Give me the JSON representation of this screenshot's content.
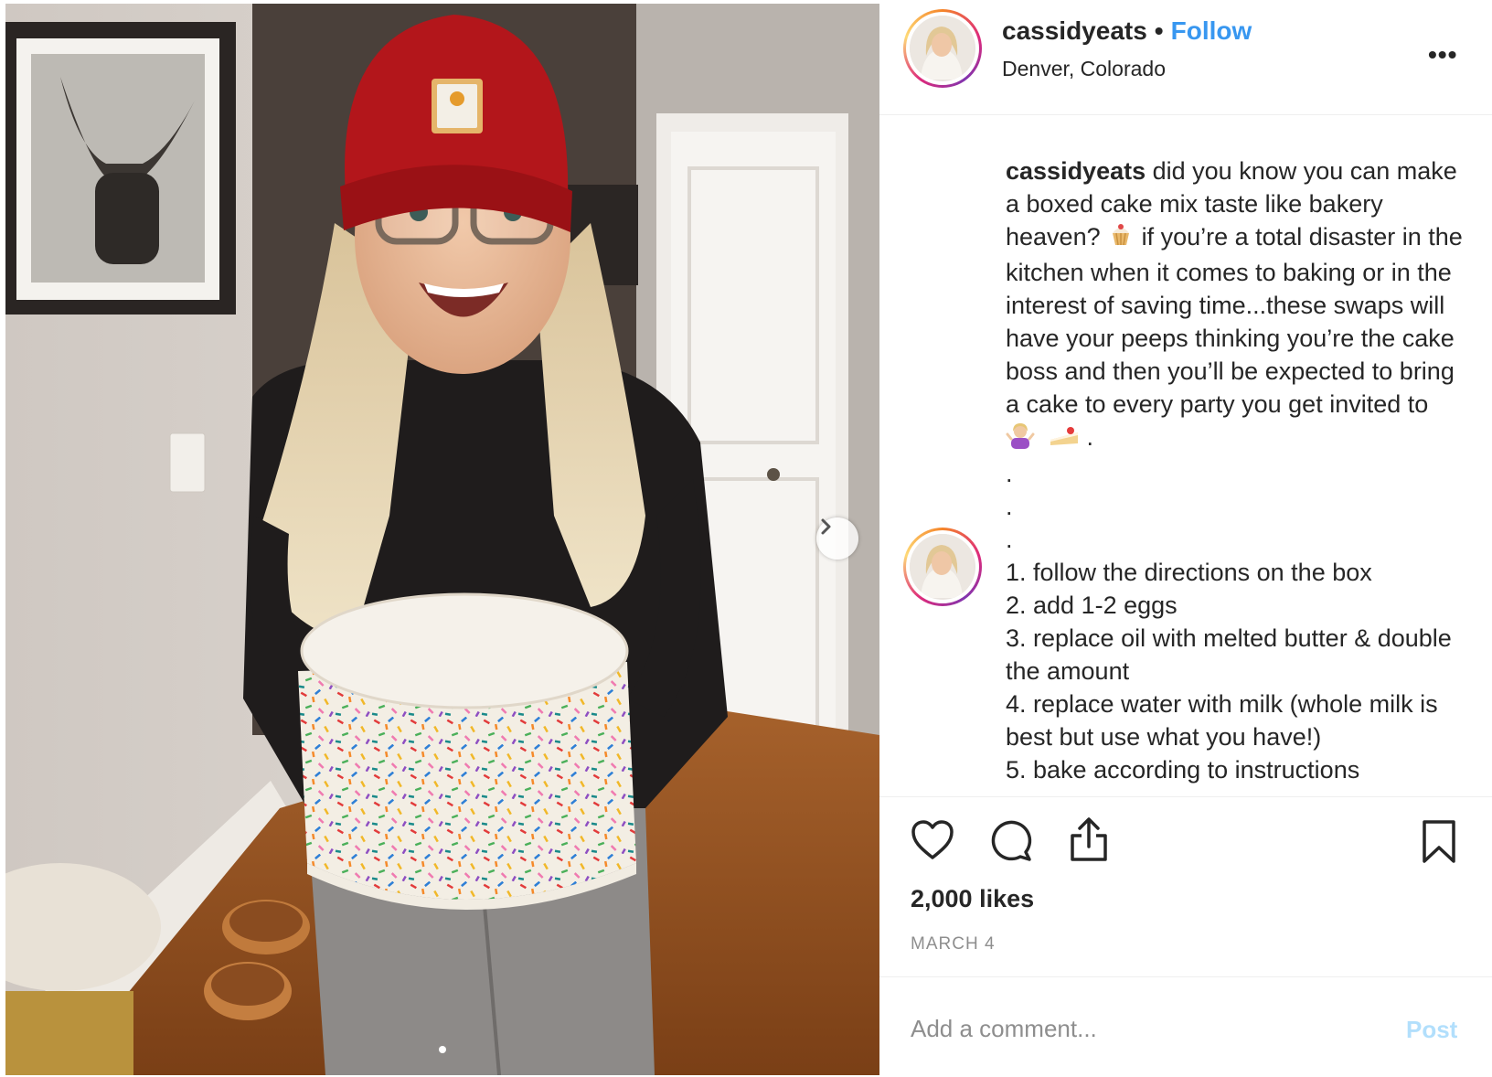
{
  "post": {
    "username": "cassidyeats",
    "separator": "•",
    "follow_label": "Follow",
    "location": "Denver, Colorado",
    "more_label": "•••"
  },
  "caption": {
    "username": "cassidyeats",
    "text_1": " did you know you can make a boxed cake mix taste like bakery heaven? ",
    "emoji_1": "cupcake-emoji",
    "text_2": " if you’re a total disaster in the kitchen when it comes to baking or in the interest of saving time...these swaps will have your peeps thinking you’re the cake boss and then you’ll be expected to bring a cake to every party you get invited to ",
    "emoji_2": "woman-shrugging-emoji",
    "emoji_3": "shortcake-emoji",
    "text_3": " .",
    "dot_lines": [
      ".",
      ".",
      "."
    ],
    "steps": [
      "1. follow the directions on the box",
      "2. add 1-2 eggs",
      "3. replace oil with melted butter & double the amount",
      "4. replace water with milk (whole milk is best but use what you have!)",
      "5. bake according to instructions"
    ]
  },
  "actions": {
    "like_icon": "heart-icon",
    "comment_icon": "comment-icon",
    "share_icon": "share-icon",
    "save_icon": "bookmark-icon",
    "likes": "2,000 likes",
    "date": "MARCH 4"
  },
  "comment": {
    "placeholder": "Add a comment...",
    "post_label": "Post"
  },
  "carousel": {
    "next_icon": "chevron-right-icon",
    "slide_count": 1,
    "active_slide": 0
  },
  "colors": {
    "follow": "#3897f0",
    "post_disabled": "#b2dffc",
    "muted": "#8e8e8e",
    "text": "#262626"
  }
}
